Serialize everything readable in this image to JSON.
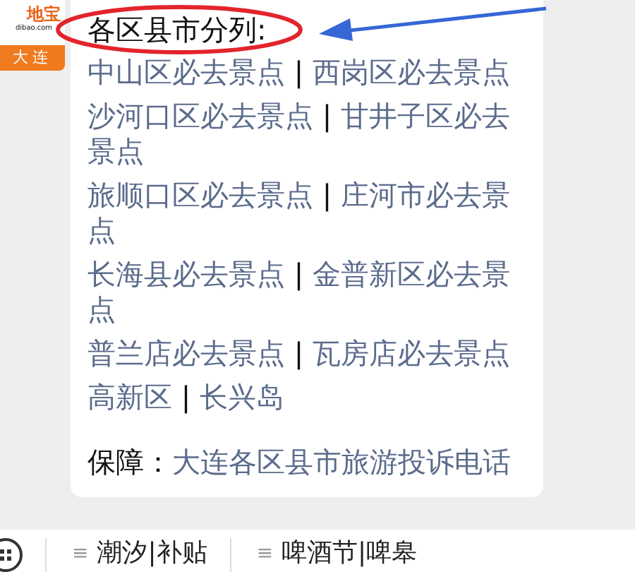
{
  "logo": {
    "brand": "地宝",
    "domain": "dibao.com",
    "city": "大连"
  },
  "article": {
    "heading": "各区县市分列:",
    "groups": [
      {
        "links": [
          "中山区必去景点",
          "西岗区必去景点"
        ],
        "separator": "|"
      },
      {
        "links": [
          "沙河口区必去景点",
          "甘井子区必去景点"
        ],
        "separator": "|"
      },
      {
        "links": [
          "旅顺口区必去景点",
          "庄河市必去景点"
        ],
        "separator": "|"
      },
      {
        "links": [
          "长海县必去景点",
          "金普新区必去景点"
        ],
        "separator": "|"
      },
      {
        "links": [
          "普兰店必去景点",
          "瓦房店必去景点"
        ],
        "separator": "|"
      },
      {
        "links": [
          "高新区",
          "长兴岛"
        ],
        "separator": "|"
      }
    ],
    "footer": {
      "label": "保障：",
      "link": "大连各区县市旅游投诉电话"
    }
  },
  "bottom_menu": [
    {
      "icon": "≡",
      "label": "潮汐|补贴"
    },
    {
      "icon": "≡",
      "label": "啤酒节|啤皋"
    }
  ]
}
